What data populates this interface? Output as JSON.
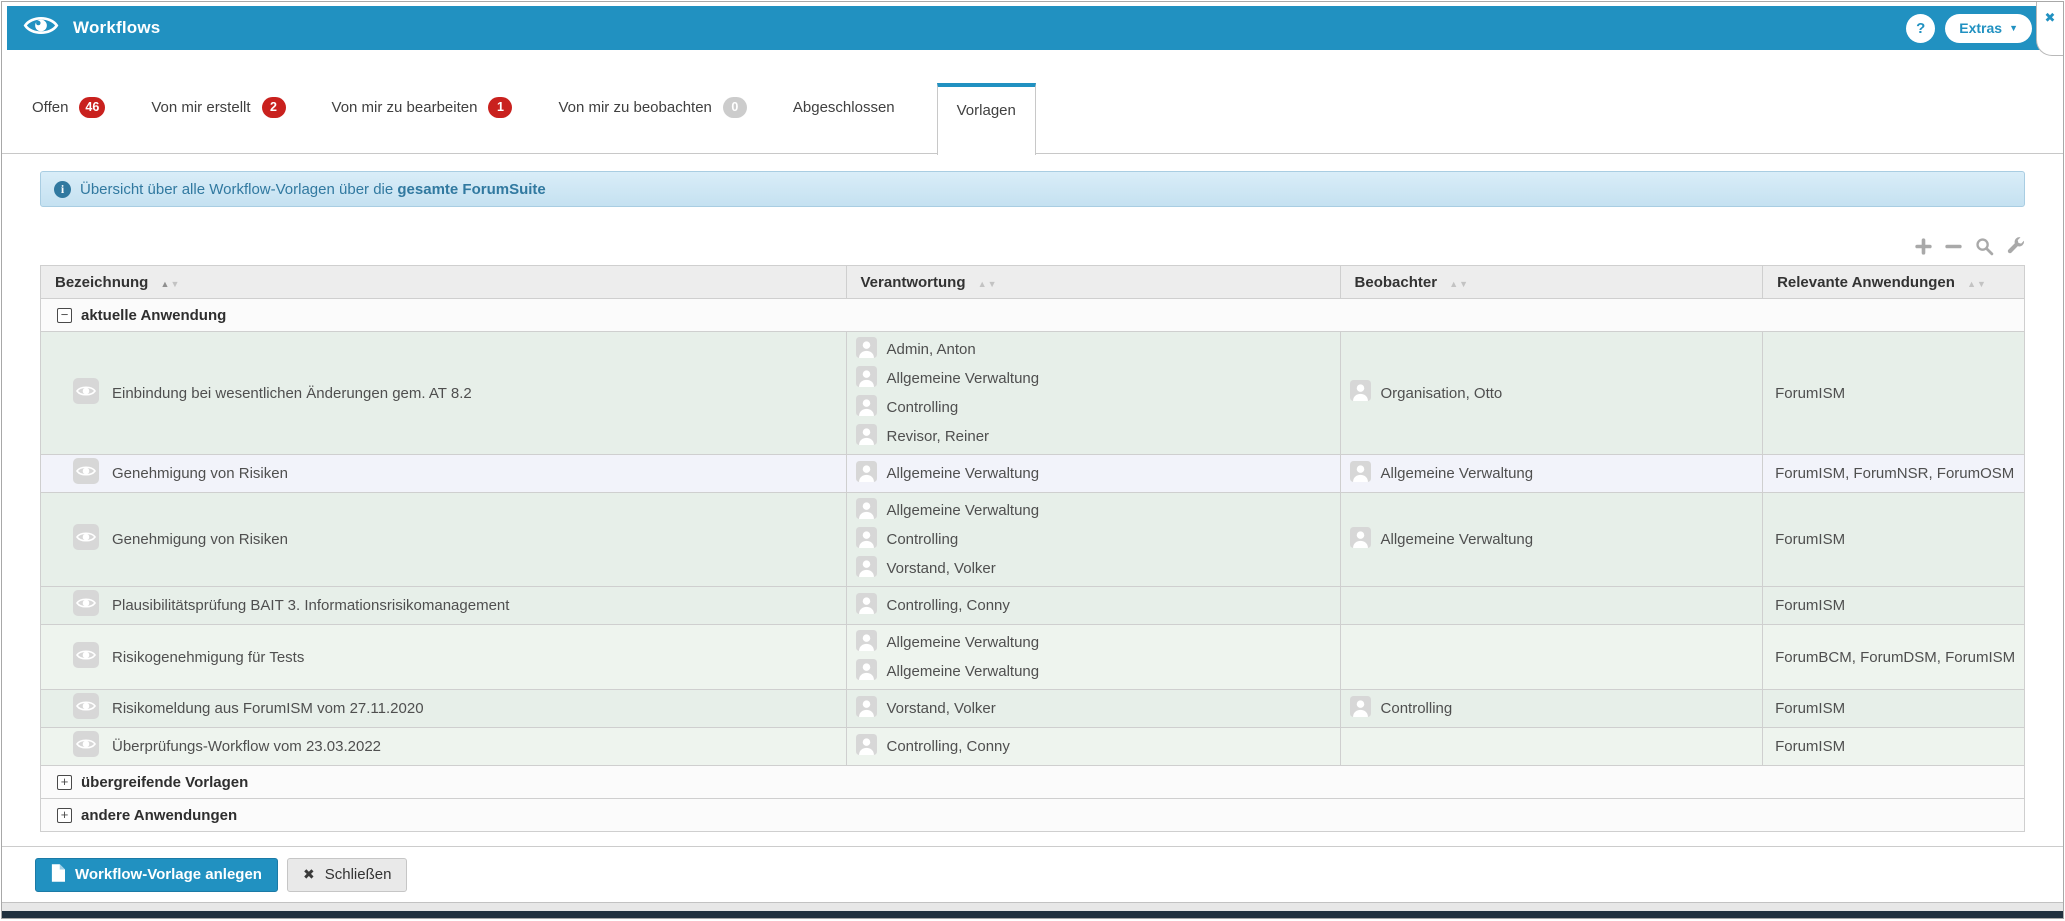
{
  "header": {
    "title": "Workflows",
    "help_label": "?",
    "extras_label": "Extras"
  },
  "tabs": [
    {
      "label": "Offen",
      "badge": "46",
      "badge_color": "red"
    },
    {
      "label": "Von mir erstellt",
      "badge": "2",
      "badge_color": "red"
    },
    {
      "label": "Von mir zu bearbeiten",
      "badge": "1",
      "badge_color": "red"
    },
    {
      "label": "Von mir zu beobachten",
      "badge": "0",
      "badge_color": "grey"
    },
    {
      "label": "Abgeschlossen"
    },
    {
      "label": "Vorlagen",
      "active": true
    }
  ],
  "info_banner": {
    "text": "Übersicht über alle Workflow-Vorlagen über die ",
    "bold_text": "gesamte ForumSuite"
  },
  "toolbar": {
    "icons": [
      "plus",
      "minus",
      "search",
      "wrench"
    ]
  },
  "table": {
    "columns": [
      {
        "label": "Bezeichnung",
        "sort_active": true
      },
      {
        "label": "Verantwortung"
      },
      {
        "label": "Beobachter"
      },
      {
        "label": "Relevante Anwendungen"
      }
    ],
    "groups": [
      {
        "label": "aktuelle Anwendung",
        "expanded": true,
        "rows": [
          {
            "tone": "g",
            "name": "Einbindung bei wesentlichen Änderungen gem. AT 8.2",
            "verantwortung": [
              "Admin, Anton",
              "Allgemeine Verwaltung",
              "Controlling",
              "Revisor, Reiner"
            ],
            "beobachter": [
              "Organisation, Otto"
            ],
            "anwendungen": "ForumISM"
          },
          {
            "tone": "hl",
            "name": "Genehmigung von Risiken",
            "verantwortung": [
              "Allgemeine Verwaltung"
            ],
            "beobachter": [
              "Allgemeine Verwaltung"
            ],
            "anwendungen": "ForumISM, ForumNSR, ForumOSM"
          },
          {
            "tone": "g",
            "name": "Genehmigung von Risiken",
            "verantwortung": [
              "Allgemeine Verwaltung",
              "Controlling",
              "Vorstand, Volker"
            ],
            "beobachter": [
              "Allgemeine Verwaltung"
            ],
            "anwendungen": "ForumISM"
          },
          {
            "tone": "g",
            "name": "Plausibilitätsprüfung BAIT 3. Informationsrisikomanagement",
            "verantwortung": [
              "Controlling, Conny"
            ],
            "beobachter": [],
            "anwendungen": "ForumISM"
          },
          {
            "tone": "l",
            "name": "Risikogenehmigung für Tests",
            "verantwortung": [
              "Allgemeine Verwaltung",
              "Allgemeine Verwaltung"
            ],
            "beobachter": [],
            "anwendungen": "ForumBCM, ForumDSM, ForumISM"
          },
          {
            "tone": "g",
            "name": "Risikomeldung aus ForumISM vom 27.11.2020",
            "verantwortung": [
              "Vorstand, Volker"
            ],
            "beobachter": [
              "Controlling"
            ],
            "anwendungen": "ForumISM"
          },
          {
            "tone": "l",
            "name": "Überprüfungs-Workflow vom 23.03.2022",
            "verantwortung": [
              "Controlling, Conny"
            ],
            "beobachter": [],
            "anwendungen": "ForumISM"
          }
        ]
      },
      {
        "label": "übergreifende Vorlagen",
        "expanded": false,
        "rows": []
      },
      {
        "label": "andere Anwendungen",
        "expanded": false,
        "rows": []
      }
    ]
  },
  "footer": {
    "create_label": "Workflow-Vorlage anlegen",
    "close_label": "Schließen"
  },
  "colors": {
    "accent": "#2191c1",
    "badge_red": "#c9211e",
    "badge_grey": "#cccccc",
    "banner_text": "#3179a0",
    "row_green": "#e7efe9",
    "row_light": "#eef4ee",
    "row_highlight": "#f2f3fa"
  }
}
